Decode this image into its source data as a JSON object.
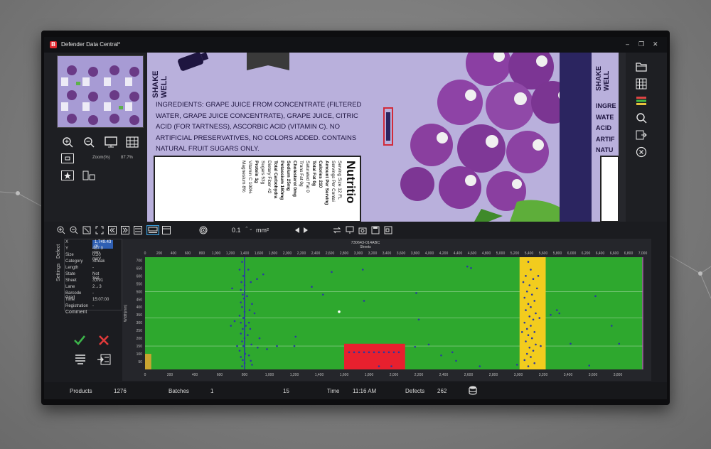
{
  "window": {
    "title": "Defender Data Central*",
    "logo_letter": "B",
    "minimize": "–",
    "restore": "❐",
    "close": "✕"
  },
  "left_panel": {
    "zoom_label": "Zoom(%)",
    "zoom_value": "87.7%"
  },
  "label_image": {
    "shake": "SHAKE WELL",
    "ingredients_lines": [
      "INGREDIENTS: GRAPE JUICE FROM CONCENTRATE (FILTERED",
      "WATER, GRAPE JUICE CONCENTRATE), GRAPE JUICE, CITRIC",
      "ACID (FOR TARTNESS), ASCORBIC ACID (VITAMIN C). NO",
      "ARTIFICIAL PRESERVATIVES, NO COLORS ADDED. CONTAINS",
      "NATURAL FRUIT SUGARS ONLY."
    ],
    "nutrition_title": "Nutritio",
    "nutrition_lines": [
      "Serving Size 12 FL",
      "Servings Per Contai",
      "Amount Per Serving",
      "Calories 210",
      "Total Fat 0g",
      "Saturated Fat 0",
      "Trans Fat 0g",
      "Cholesterol 0mg",
      "Sodium 25mg",
      "Potassium 160mg",
      "Total Carbohydra",
      "Dietary Fiber 42",
      "Sugars 53g",
      "Protein 1g",
      "Vitamin C 100%",
      "Magnesium 8%"
    ],
    "right_shake": "SHAKE WELL",
    "right_ing": [
      "INGRE",
      "WATE",
      "ACID",
      "ARTIF",
      "NATU"
    ]
  },
  "toolbar": {
    "step_value": "0.1",
    "unit": "mm²"
  },
  "properties": {
    "tabs": [
      "Defect",
      "Settings"
    ],
    "rows": [
      {
        "label": "X",
        "value": "1,749.43 m"
      },
      {
        "label": "Y",
        "value": "467.9 mm"
      },
      {
        "label": "Size",
        "value": "0.20 mm²"
      },
      {
        "label": "Category",
        "value": "Streak"
      },
      {
        "label": "Length",
        "value": "-"
      },
      {
        "label": "State",
        "value": "Not Set"
      },
      {
        "label": "Sheet",
        "value": "3,091"
      },
      {
        "label": "Lane",
        "value": "2→3"
      },
      {
        "label": "Barcode Grad",
        "value": "-"
      },
      {
        "label": "Time",
        "value": "15:07:00"
      },
      {
        "label": "Registration",
        "value": "-"
      }
    ],
    "comment_label": "Comment"
  },
  "chart_data": {
    "type": "scatter",
    "title": "730643-014ABC",
    "top_axis_label": "Sheets",
    "ylabel": "Width[mm]",
    "top_ticks": [
      "0",
      "200",
      "400",
      "600",
      "800",
      "1,000",
      "1,200",
      "1,400",
      "1,600",
      "1,800",
      "2,000",
      "2,200",
      "2,400",
      "2,600",
      "2,800",
      "3,000",
      "3,200",
      "3,400",
      "3,600",
      "3,800",
      "4,000",
      "4,200",
      "4,400",
      "4,600",
      "4,800",
      "5,000",
      "5,200",
      "5,400",
      "5,600",
      "5,800",
      "6,000",
      "6,200",
      "6,400",
      "6,600",
      "6,800",
      "7,000"
    ],
    "bottom_ticks": [
      "0",
      "200",
      "400",
      "600",
      "800",
      "1,000",
      "1,200",
      "1,400",
      "1,600",
      "1,800",
      "2,000",
      "2,200",
      "2,400",
      "2,600",
      "2,800",
      "3,000",
      "3,200",
      "3,400",
      "3,600",
      "3,800"
    ],
    "y_ticks": [
      "700",
      "650",
      "600",
      "550",
      "500",
      "450",
      "400",
      "350",
      "300",
      "250",
      "200",
      "150",
      "100",
      "50"
    ],
    "xlim": [
      0,
      4000
    ],
    "ylim": [
      0,
      720
    ],
    "colors": {
      "background": "#2ea82e",
      "streak": "#f2cc1e",
      "defect_zone": "#e8202e",
      "points": "#2a3aa0",
      "marker": "#c9a530",
      "line": "#2a3aa0"
    },
    "regions": [
      {
        "name": "streak",
        "x0": 3010,
        "x1": 3220,
        "y0": 0,
        "y1": 720
      },
      {
        "name": "defect-zone",
        "x0": 1600,
        "x1": 2090,
        "y0": 0,
        "y1": 165
      }
    ],
    "vertical_line_x": 800,
    "points": [
      [
        780,
        690
      ],
      [
        760,
        640
      ],
      [
        790,
        600
      ],
      [
        775,
        560
      ],
      [
        800,
        540
      ],
      [
        770,
        510
      ],
      [
        785,
        480
      ],
      [
        795,
        455
      ],
      [
        770,
        430
      ],
      [
        780,
        400
      ],
      [
        800,
        370
      ],
      [
        760,
        345
      ],
      [
        790,
        330
      ],
      [
        770,
        300
      ],
      [
        810,
        280
      ],
      [
        785,
        260
      ],
      [
        770,
        230
      ],
      [
        800,
        200
      ],
      [
        780,
        180
      ],
      [
        790,
        150
      ],
      [
        760,
        120
      ],
      [
        805,
        100
      ],
      [
        770,
        80
      ],
      [
        785,
        60
      ],
      [
        800,
        40
      ],
      [
        780,
        20
      ],
      [
        830,
        640
      ],
      [
        850,
        560
      ],
      [
        820,
        470
      ],
      [
        860,
        420
      ],
      [
        840,
        380
      ],
      [
        835,
        300
      ],
      [
        845,
        260
      ],
      [
        825,
        220
      ],
      [
        855,
        160
      ],
      [
        835,
        90
      ],
      [
        850,
        55
      ],
      [
        860,
        30
      ],
      [
        700,
        520
      ],
      [
        900,
        580
      ],
      [
        880,
        360
      ],
      [
        920,
        200
      ],
      [
        905,
        140
      ],
      [
        690,
        280
      ],
      [
        720,
        310
      ],
      [
        740,
        150
      ],
      [
        1200,
        150
      ],
      [
        1060,
        150
      ],
      [
        1210,
        210
      ],
      [
        980,
        130
      ],
      [
        950,
        610
      ],
      [
        1500,
        625
      ],
      [
        1340,
        530
      ],
      [
        1430,
        480
      ],
      [
        1560,
        370
      ],
      [
        1760,
        440
      ],
      [
        1880,
        20
      ],
      [
        1980,
        20
      ],
      [
        2200,
        320
      ],
      [
        2280,
        160
      ],
      [
        2180,
        490
      ],
      [
        2590,
        660
      ],
      [
        2620,
        650
      ],
      [
        1750,
        640
      ],
      [
        2500,
        55
      ],
      [
        2690,
        20
      ],
      [
        2990,
        30
      ],
      [
        2380,
        90
      ],
      [
        2170,
        145
      ],
      [
        3420,
        165
      ],
      [
        3570,
        25
      ],
      [
        3620,
        470
      ],
      [
        3310,
        380
      ],
      [
        3750,
        280
      ],
      [
        3810,
        165
      ],
      [
        3260,
        350
      ],
      [
        3330,
        360
      ],
      [
        2470,
        110
      ],
      [
        3080,
        690
      ],
      [
        3100,
        640
      ],
      [
        3060,
        600
      ],
      [
        3120,
        580
      ],
      [
        3040,
        560
      ],
      [
        3090,
        540
      ],
      [
        3150,
        520
      ],
      [
        3070,
        500
      ],
      [
        3110,
        480
      ],
      [
        3050,
        460
      ],
      [
        3130,
        440
      ],
      [
        3080,
        420
      ],
      [
        3100,
        400
      ],
      [
        3060,
        380
      ],
      [
        3140,
        360
      ],
      [
        3090,
        340
      ],
      [
        3120,
        320
      ],
      [
        3050,
        300
      ],
      [
        3100,
        280
      ],
      [
        3070,
        260
      ],
      [
        3130,
        240
      ],
      [
        3080,
        220
      ],
      [
        3110,
        200
      ],
      [
        3060,
        180
      ],
      [
        3140,
        160
      ],
      [
        3090,
        140
      ],
      [
        3120,
        120
      ],
      [
        3070,
        100
      ],
      [
        3100,
        80
      ],
      [
        3050,
        60
      ],
      [
        3130,
        40
      ],
      [
        3080,
        20
      ],
      [
        3160,
        600
      ],
      [
        3170,
        330
      ],
      [
        3030,
        240
      ],
      [
        3180,
        150
      ],
      [
        1640,
        110
      ],
      [
        1680,
        110
      ],
      [
        1720,
        110
      ],
      [
        1760,
        110
      ],
      [
        1800,
        110
      ],
      [
        1840,
        110
      ],
      [
        1880,
        110
      ],
      [
        1920,
        110
      ],
      [
        1960,
        110
      ],
      [
        2000,
        110
      ],
      [
        2040,
        110
      ]
    ],
    "highlight_point": [
      1560,
      370
    ],
    "marker_x": [
      0,
      50
    ]
  },
  "status": {
    "products_label": "Products",
    "products_value": "1276",
    "batches_label": "Batches",
    "batches_value": "1",
    "lanes_value": "15",
    "time_label": "Time",
    "time_value": "11:16 AM",
    "defects_label": "Defects",
    "defects_value": "262"
  }
}
